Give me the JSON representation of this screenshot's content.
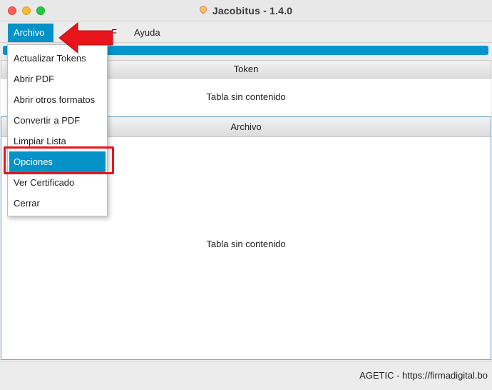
{
  "window": {
    "title": "Jacobitus - 1.4.0"
  },
  "menubar": {
    "items": [
      {
        "label": "Archivo"
      },
      {
        "label": "F"
      },
      {
        "label": "Ayuda"
      }
    ]
  },
  "menu_archivo": {
    "items": [
      {
        "label": "Actualizar Tokens"
      },
      {
        "label": "Abrir PDF"
      },
      {
        "label": "Abrir otros formatos"
      },
      {
        "label": "Convertir a PDF"
      },
      {
        "label": "Limpiar Lista"
      },
      {
        "label": "Opciones",
        "selected": true
      },
      {
        "label": "Ver Certificado"
      },
      {
        "label": "Cerrar"
      }
    ]
  },
  "token_panel": {
    "header": "Token",
    "empty_text": "Tabla sin contenido"
  },
  "archivo_panel": {
    "header": "Archivo",
    "empty_text": "Tabla sin contenido"
  },
  "statusbar": {
    "text": "AGETIC - https://firmadigital.bo"
  },
  "colors": {
    "accent": "#0592c8",
    "annotation_red": "#e8141b"
  },
  "icons": {
    "app": "droplet-icon",
    "annotation": "arrow-left-icon"
  }
}
